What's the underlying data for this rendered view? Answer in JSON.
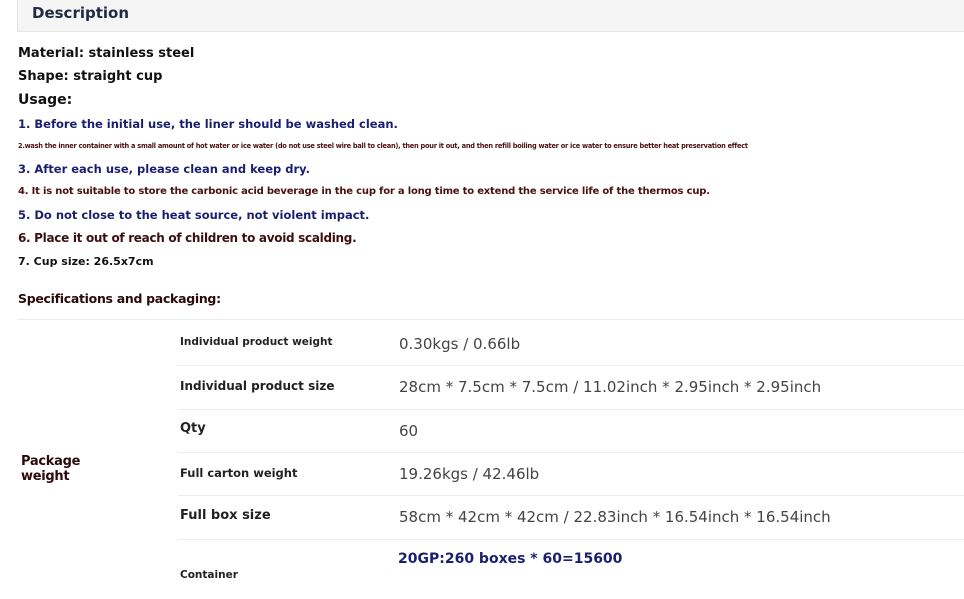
{
  "description": {
    "title": "Description",
    "material": "Material: stainless steel",
    "shape": "Shape: straight cup",
    "usage_heading": "Usage:",
    "usage_items": [
      "1. Before the initial use, the liner should be washed clean.",
      "2.wash the inner container with a small amount of hot water or ice water (do not use steel wire ball to clean), then pour it out, and then refill boiling water or ice water to ensure better heat preservation effect",
      "3. After each use, please clean and keep dry.",
      "4. It is not suitable to store the carbonic acid beverage in the cup for a long time to extend the service life of the thermos cup.",
      "5. Do not close to the heat source, not violent impact.",
      "6. Place it out of reach of children to avoid scalding.",
      "7. Cup size: 26.5x7cm"
    ]
  },
  "specs": {
    "heading": "Specifications and packaging:",
    "group_label_line1": "Package",
    "group_label_line2": "weight",
    "rows": [
      {
        "label": "Individual product weight",
        "value": "0.30kgs / 0.66lb"
      },
      {
        "label": "Individual product size",
        "value": "28cm * 7.5cm * 7.5cm / 11.02inch * 2.95inch * 2.95inch"
      },
      {
        "label": "Qty",
        "value": "60"
      },
      {
        "label": "Full carton weight",
        "value": "19.26kgs / 42.46lb"
      },
      {
        "label": "Full box size",
        "value": "58cm * 42cm * 42cm / 22.83inch * 16.54inch * 16.54inch"
      },
      {
        "label": "Container",
        "value": "20GP:260 boxes * 60=15600"
      }
    ]
  }
}
